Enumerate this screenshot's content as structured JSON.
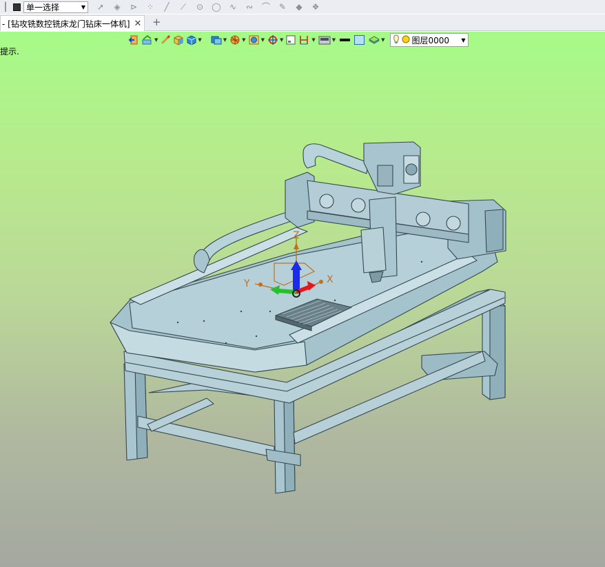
{
  "toolbar": {
    "selection_mode": "单一选择"
  },
  "tabs": [
    {
      "label": "- [钻攻铣数控铣床龙门钻床一体机]",
      "close": "✕"
    }
  ],
  "new_tab": "+",
  "viewport": {
    "hint": "提示.",
    "layer": "图层0000"
  },
  "triad": {
    "x": "X",
    "y": "Y",
    "z": "Z"
  },
  "colors": {
    "machine_fill": "#a9c5cf",
    "machine_edge": "#34474f",
    "axis_x": "#e8161a",
    "axis_y": "#26c02b",
    "axis_z": "#1a2ee8",
    "workplane": "#c07020"
  },
  "icons": [
    "pointer-icon",
    "vertex-icon",
    "play-icon",
    "points-icon",
    "line-icon",
    "polyline-icon",
    "point-circle-icon",
    "circle-icon",
    "spline-icon",
    "wave-icon",
    "arc-icon",
    "pen-icon",
    "layers-a-icon",
    "layers-b-icon"
  ]
}
